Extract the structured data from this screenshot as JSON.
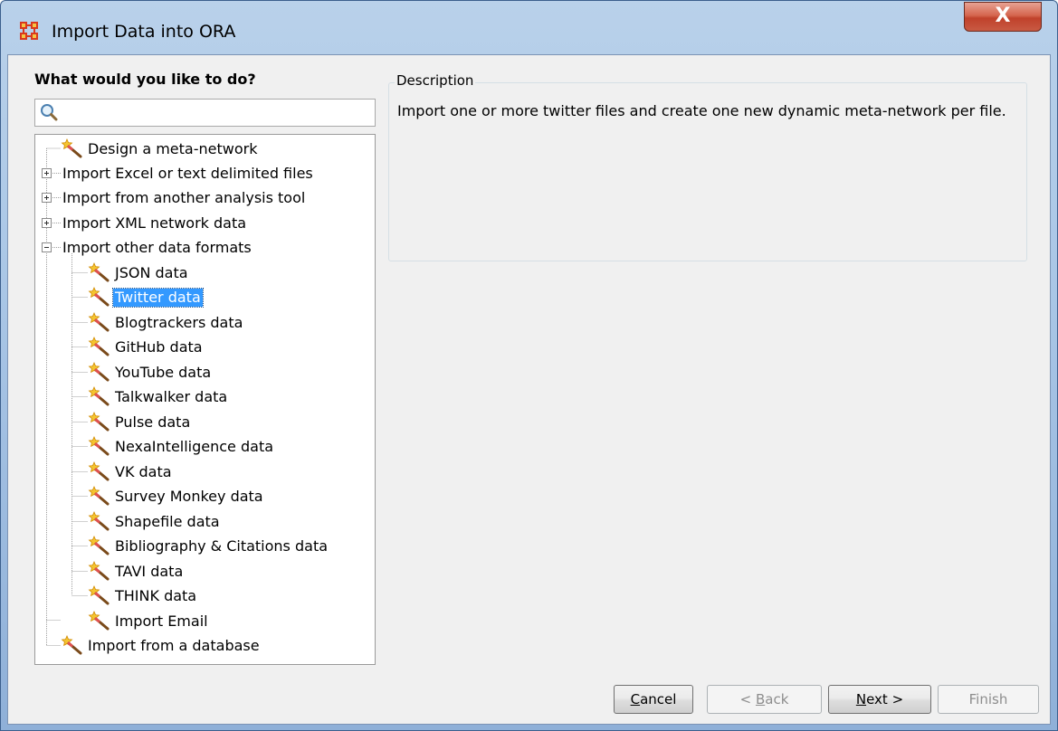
{
  "window": {
    "title": "Import Data into ORA",
    "close_label": "X",
    "app_icon": "ora-network-icon"
  },
  "left_panel": {
    "heading": "What would you like to do?",
    "search": {
      "value": "",
      "placeholder": "",
      "icon": "search-icon"
    }
  },
  "tree": {
    "items": [
      {
        "label": "Design a meta-network",
        "icon": "wand-icon",
        "expander": "none",
        "selected": false
      },
      {
        "label": "Import Excel or text delimited files",
        "icon": "none",
        "expander": "plus",
        "selected": false
      },
      {
        "label": "Import from another analysis tool",
        "icon": "none",
        "expander": "plus",
        "selected": false
      },
      {
        "label": "Import XML network data",
        "icon": "none",
        "expander": "plus",
        "selected": false
      },
      {
        "label": "Import other data formats",
        "icon": "none",
        "expander": "minus",
        "selected": false
      },
      {
        "label": "JSON data",
        "icon": "wand-icon",
        "expander": "none",
        "selected": false
      },
      {
        "label": "Twitter data",
        "icon": "wand-icon",
        "expander": "none",
        "selected": true
      },
      {
        "label": "Blogtrackers data",
        "icon": "wand-icon",
        "expander": "none",
        "selected": false
      },
      {
        "label": "GitHub data",
        "icon": "wand-icon",
        "expander": "none",
        "selected": false
      },
      {
        "label": "YouTube data",
        "icon": "wand-icon",
        "expander": "none",
        "selected": false
      },
      {
        "label": "Talkwalker data",
        "icon": "wand-icon",
        "expander": "none",
        "selected": false
      },
      {
        "label": "Pulse data",
        "icon": "wand-icon",
        "expander": "none",
        "selected": false
      },
      {
        "label": "NexaIntelligence data",
        "icon": "wand-icon",
        "expander": "none",
        "selected": false
      },
      {
        "label": "VK data",
        "icon": "wand-icon",
        "expander": "none",
        "selected": false
      },
      {
        "label": "Survey Monkey data",
        "icon": "wand-icon",
        "expander": "none",
        "selected": false
      },
      {
        "label": "Shapefile data",
        "icon": "wand-icon",
        "expander": "none",
        "selected": false
      },
      {
        "label": "Bibliography & Citations data",
        "icon": "wand-icon",
        "expander": "none",
        "selected": false
      },
      {
        "label": "TAVI data",
        "icon": "wand-icon",
        "expander": "none",
        "selected": false
      },
      {
        "label": "THINK data",
        "icon": "wand-icon",
        "expander": "none",
        "selected": false
      },
      {
        "label": "Import Email",
        "icon": "wand-icon",
        "expander": "none",
        "selected": false
      },
      {
        "label": "Import from a database",
        "icon": "wand-icon",
        "expander": "none",
        "selected": false
      }
    ]
  },
  "description": {
    "legend": "Description",
    "text": "Import one or more twitter files and create one new dynamic meta-network per file."
  },
  "buttons": {
    "cancel": {
      "label_mnemonic": "C",
      "label_rest": "ancel",
      "enabled": true
    },
    "back": {
      "label_prefix": "< ",
      "label_mnemonic": "B",
      "label_rest": "ack",
      "enabled": false
    },
    "next": {
      "label_mnemonic": "N",
      "label_rest": "ext >",
      "enabled": true
    },
    "finish": {
      "label": "Finish",
      "enabled": false
    }
  },
  "colors": {
    "selection": "#3399ff",
    "close_button": "#c0412b",
    "title_gradient_top": "#b9d1ea"
  }
}
